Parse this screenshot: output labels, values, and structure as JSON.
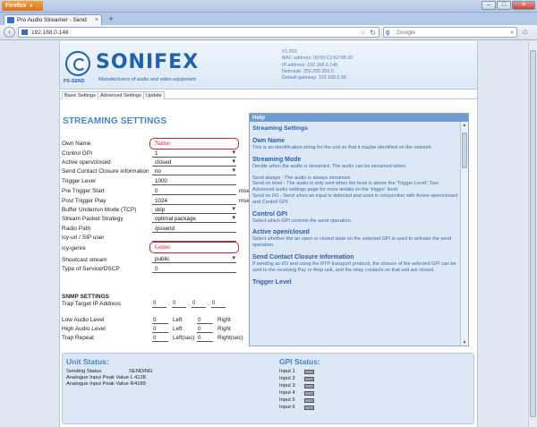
{
  "browser": {
    "menu_label": "Firefox",
    "tab_title": "Pro Audio Streamer - Send",
    "url": "192.168.0.148",
    "search_placeholder": "Google",
    "controls": {
      "minimize": "–",
      "maximize": "□",
      "close": "✕"
    }
  },
  "header": {
    "brand": "SONIFEX",
    "product_code": "PS-SEND",
    "tagline": "Manufacturers of audio and video equipment",
    "info": [
      "V1.815",
      "MAC address: 00:50:C2:62:5B:20",
      "IP address: 192.168.0.148",
      "Netmask: 255.255.255.0",
      "Default gateway: 192.168.0.99"
    ]
  },
  "subnav": [
    "Basic Settings",
    "Advanced Settings",
    "Update"
  ],
  "form": {
    "title": "STREAMING SETTINGS",
    "own_name": {
      "label": "Own Name",
      "value": "Name"
    },
    "control_gpi": {
      "label": "Control GPI",
      "value": "1"
    },
    "active_open_closed": {
      "label": "Active open/closed",
      "value": "closed"
    },
    "send_contact_closure": {
      "label": "Send Contact Closure information",
      "value": "no"
    },
    "trigger_level": {
      "label": "Trigger Level",
      "value": "1000"
    },
    "pre_trigger_start": {
      "label": "Pre Trigger Start",
      "value": "0",
      "unit": "msec"
    },
    "post_trigger_play": {
      "label": "Post Trigger Play",
      "value": "1024",
      "unit": "msec"
    },
    "buffer_underrun": {
      "label": "Buffer Underrun Mode (TCP)",
      "value": "skip"
    },
    "stream_packet_strategy": {
      "label": "Stream Packet Strategy",
      "value": "optimal package"
    },
    "radio_path": {
      "label": "Radio Path",
      "value": "/pssend"
    },
    "icy_url": {
      "label": "icy-url / SIP user",
      "value": ""
    },
    "icy_genre": {
      "label": "icy-genre",
      "value": "Genre"
    },
    "shoutcast_stream": {
      "label": "Shoutcast stream",
      "value": "public"
    },
    "tos_dscp": {
      "label": "Type of Service/DSCP",
      "value": "0"
    }
  },
  "snmp": {
    "title": "SNMP SETTINGS",
    "trap_target_label": "Trap Target IP Address",
    "trap_target_octets": [
      "0",
      "0",
      "0",
      "0"
    ],
    "low_audio": {
      "label": "Low Audio Level",
      "left": "0",
      "left_label": "Left",
      "right": "0",
      "right_label": "Right"
    },
    "high_audio": {
      "label": "High Audio Level",
      "left": "0",
      "left_label": "Left",
      "right": "0",
      "right_label": "Right"
    },
    "trap_repeat": {
      "label": "Trap Repeat",
      "left": "0",
      "left_label": "Left(sec)",
      "right": "0",
      "right_label": "Right(sec)"
    }
  },
  "help": {
    "header": "Help",
    "title": "Streaming Settings",
    "sections": [
      {
        "heading": "Own Name",
        "text": "This is an identification string for the unit so that it maybe identified on the network."
      },
      {
        "heading": "Streaming Mode",
        "text": "Decide when the audio is streamed. The audio can be streamed when:"
      },
      {
        "heading": "",
        "text": "Send always - The audio is always streamed."
      },
      {
        "heading": "",
        "text": "Send on level - The audio is only sent when the level is above the 'Trigger Level'. See Advanced audio settings page for more details on the 'trigger' level."
      },
      {
        "heading": "",
        "text": "Send on I/O - Send when an input is detected and used in conjunction with Active open/closed and Control GPI."
      },
      {
        "heading": "Control GPI",
        "text": "Select which GPI controls the send operation."
      },
      {
        "heading": "Active open/closed",
        "text": "Select whether the an open or closed state on the selected GPI is used to activate the send operation."
      },
      {
        "heading": "Send Contact Closure Information",
        "text": "If sending as I/O and using the RTP transport protocol, the closure of the selected GPI can be sent to the receiving Pay or Amp unit, and the relay contacts on that unit are closed."
      },
      {
        "heading": "Trigger Level",
        "text": ""
      }
    ]
  },
  "unit_status": {
    "title": "Unit Status:",
    "rows": [
      {
        "label": "Sending Status",
        "value": "SENDING"
      },
      {
        "label": "Analogue Input Peak Value L",
        "value": "4128"
      },
      {
        "label": "Analogue Input Peak Value R",
        "value": "4189"
      }
    ]
  },
  "gpi_status": {
    "title": "GPI Status:",
    "inputs": [
      "Input 1",
      "Input 2",
      "Input 3",
      "Input 4",
      "Input 5",
      "Input 6"
    ],
    "led_color": "#9aa1a8"
  },
  "colors": {
    "accent": "#3f86d5",
    "highlight": "#d8202b",
    "brand": "#1f62b4"
  }
}
